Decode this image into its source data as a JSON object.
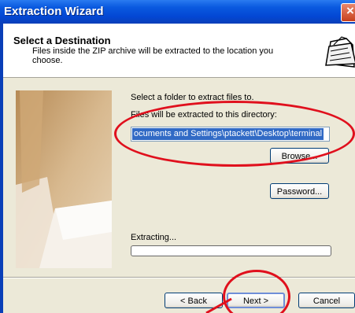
{
  "window": {
    "title": "Extraction Wizard"
  },
  "header": {
    "title": "Select a Destination",
    "description": "Files inside the ZIP archive will be extracted to the location you choose."
  },
  "content": {
    "select_label": "Select a folder to extract files to.",
    "directory_label": "Files will be extracted to this directory:",
    "path_value": "ocuments and Settings\\ptackett\\Desktop\\terminal",
    "browse_label": "Browse...",
    "password_label": "Password...",
    "extracting_label": "Extracting...",
    "progress_fraction": 0
  },
  "footer": {
    "back_label": "< Back",
    "next_label": "Next >",
    "cancel_label": "Cancel"
  },
  "colors": {
    "titlebar": "#0a5ae0",
    "highlight": "#316ac5",
    "annotation": "#e0101d"
  }
}
